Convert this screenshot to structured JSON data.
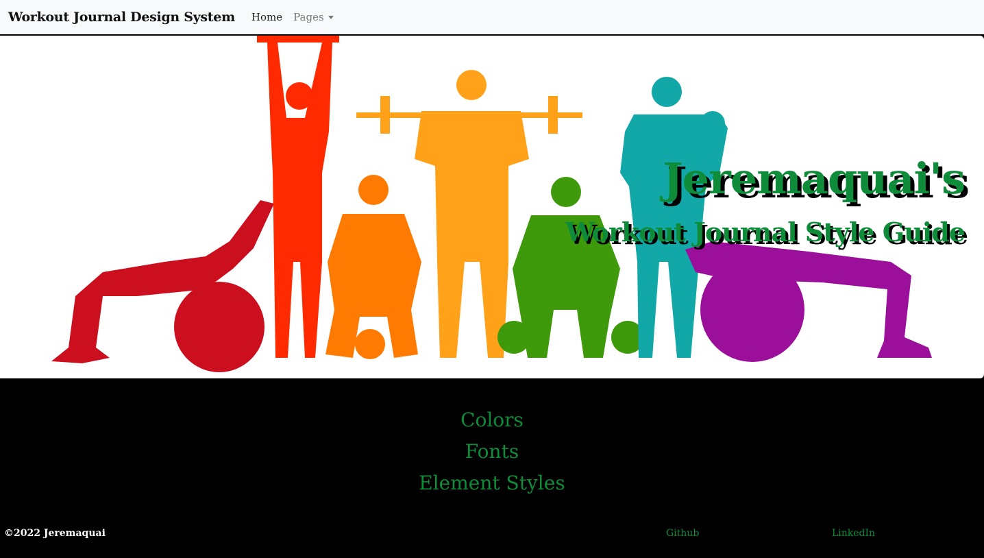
{
  "navbar": {
    "brand": "Workout Journal Design System",
    "home_label": "Home",
    "pages_label": "Pages"
  },
  "hero": {
    "title": "Jeremaquai's",
    "subtitle": "Workout Journal Style Guide",
    "image_name": "fitness-silhouettes-illustration",
    "title_color": "#0e8c3a",
    "figure_colors": [
      "#cc0f1f",
      "#ff2a00",
      "#ff7a00",
      "#ffa21a",
      "#3e9a0a",
      "#12a8a8",
      "#9b0f9b"
    ]
  },
  "sections": [
    {
      "label": "Colors"
    },
    {
      "label": "Fonts"
    },
    {
      "label": "Element Styles"
    }
  ],
  "footer": {
    "copyright": "©2022 Jeremaquai",
    "github": "Github",
    "linkedin": "LinkedIn"
  }
}
